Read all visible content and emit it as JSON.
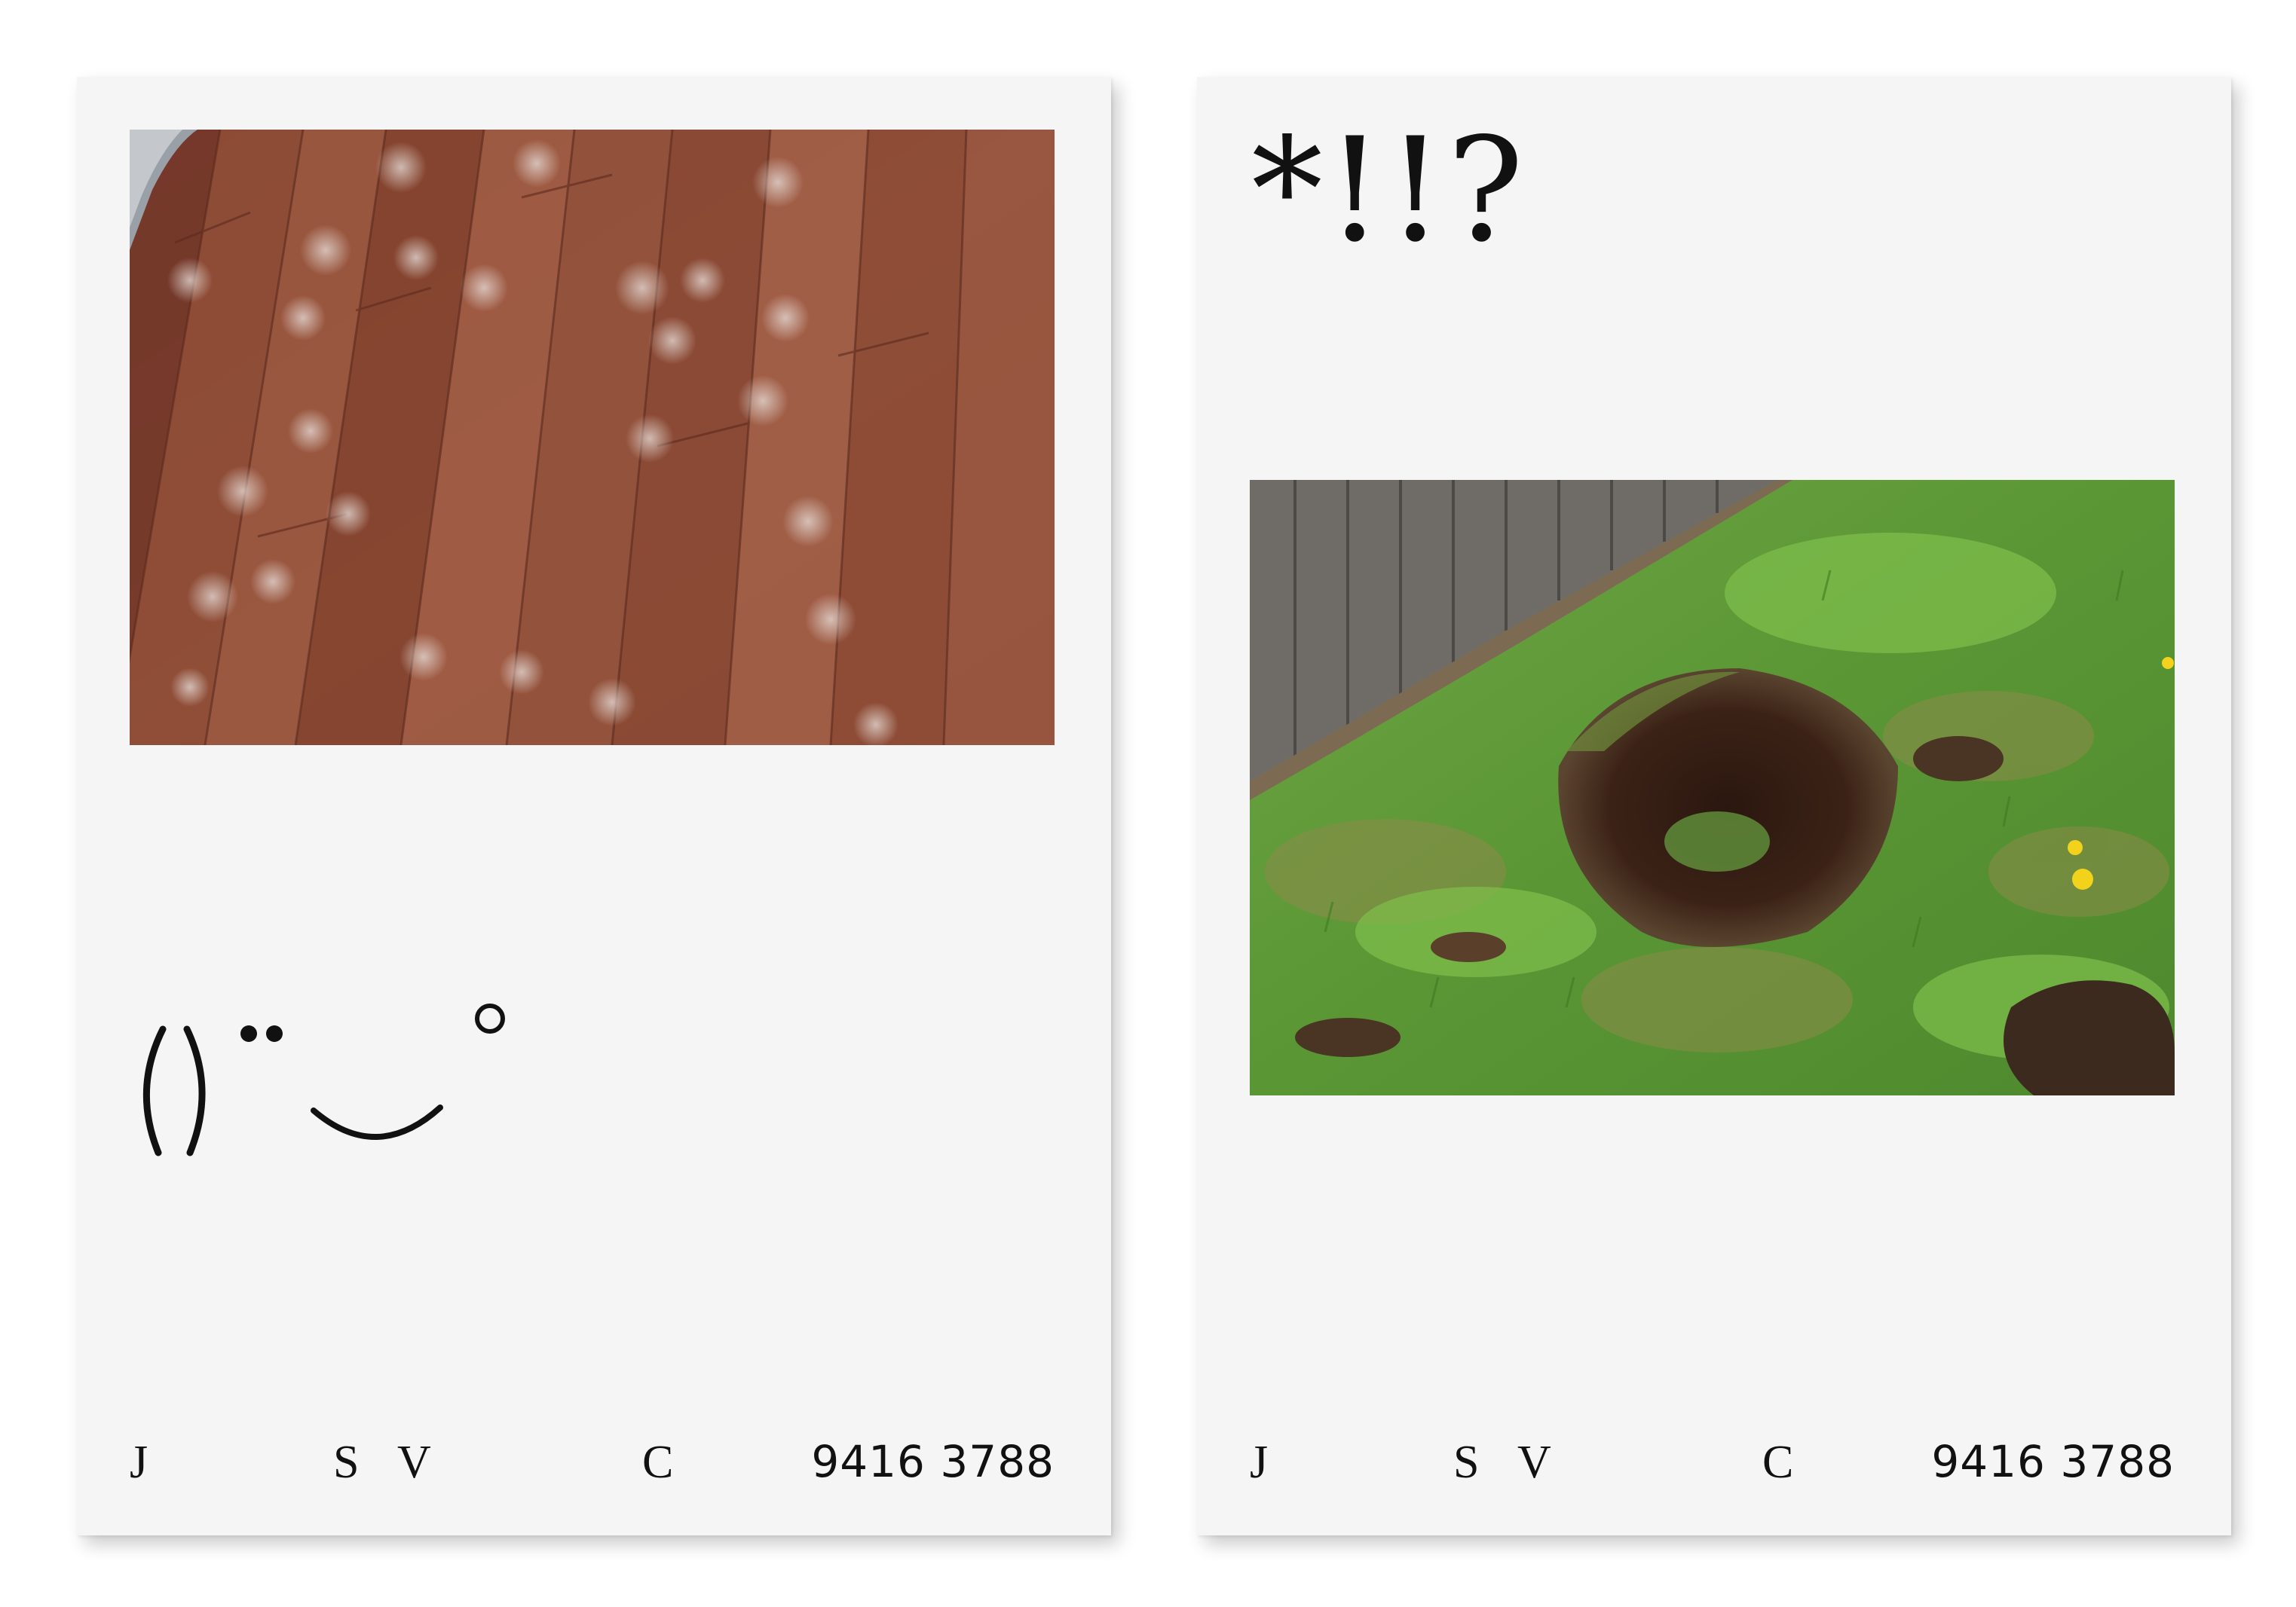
{
  "cards": [
    {
      "photo": "wood floor with paw prints",
      "glyphs": "()••‿°",
      "footer": {
        "letters": [
          "J",
          "S",
          "V",
          "C"
        ],
        "phone": "9416 3788"
      }
    },
    {
      "photo": "lawn with dug hole",
      "glyphs": "*!!?",
      "footer": {
        "letters": [
          "J",
          "S",
          "V",
          "C"
        ],
        "phone": "9416 3788"
      }
    }
  ],
  "colors": {
    "card": "#f5f5f5",
    "ink": "#111111",
    "wood": "#8a4a34",
    "grass": "#5f9b3a",
    "soil": "#3a2418",
    "fence": "#6e6b66"
  }
}
